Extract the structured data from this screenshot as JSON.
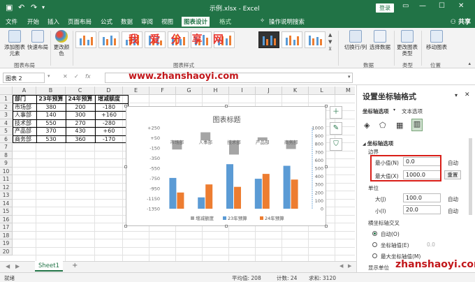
{
  "window": {
    "title": "示例.xlsx - Excel",
    "login": "登录",
    "share": "共享"
  },
  "tabs": [
    "文件",
    "开始",
    "插入",
    "页面布局",
    "公式",
    "数据",
    "审阅",
    "视图",
    "图表设计",
    "格式"
  ],
  "tell_me": "操作说明搜索",
  "ribbon": {
    "buttons": [
      "添加图表元素",
      "快速布局",
      "更改颜色",
      "切换行/列",
      "选择数据",
      "更改图表类型",
      "移动图表"
    ],
    "groups": [
      "图表布局",
      "图表样式",
      "数据",
      "类型",
      "位置"
    ]
  },
  "watermark": {
    "cn": "我 爱 分 享 网",
    "url": "www.zhanshaoyi.com",
    "corner": "zhanshaoyi.com"
  },
  "formula_bar": {
    "name_box": "图表 2",
    "fx": "fx"
  },
  "grid": {
    "columns": [
      "A",
      "B",
      "C",
      "D",
      "E",
      "F",
      "G",
      "H",
      "I",
      "J",
      "K",
      "L",
      "M"
    ],
    "rows": [
      "1",
      "2",
      "3",
      "4",
      "5",
      "6",
      "7",
      "8",
      "9",
      "10",
      "11",
      "12",
      "13",
      "14",
      "15",
      "16",
      "17",
      "18",
      "19",
      "20"
    ],
    "table": [
      [
        "部门",
        "23年预算",
        "24年预算",
        "增减额度"
      ],
      [
        "市场部",
        "380",
        "200",
        "-180"
      ],
      [
        "人事部",
        "140",
        "300",
        "+160"
      ],
      [
        "技术部",
        "550",
        "270",
        "-280"
      ],
      [
        "产品部",
        "370",
        "430",
        "+60"
      ],
      [
        "商务部",
        "530",
        "360",
        "-170"
      ]
    ]
  },
  "chart_data": {
    "type": "bar",
    "title": "图表标题",
    "categories": [
      "市场部",
      "人事部",
      "技术部",
      "产品部",
      "商务部"
    ],
    "series": [
      {
        "name": "增减额度",
        "values": [
          -180,
          160,
          -280,
          60,
          -170
        ],
        "color": "#a5a5a5",
        "axis": "left"
      },
      {
        "name": "23年预算",
        "values": [
          380,
          140,
          550,
          370,
          530
        ],
        "color": "#5b9bd5",
        "axis": "right"
      },
      {
        "name": "24年预算",
        "values": [
          200,
          300,
          270,
          430,
          360
        ],
        "color": "#ed7d31",
        "axis": "right"
      }
    ],
    "left_axis": {
      "ticks": [
        "+250",
        "+50",
        "-150",
        "-350",
        "-550",
        "-750",
        "-950",
        "-1150",
        "-1350"
      ],
      "min": -1350,
      "max": 250
    },
    "right_axis": {
      "ticks": [
        "1000",
        "900",
        "800",
        "700",
        "600",
        "500",
        "400",
        "300",
        "200",
        "100",
        "0"
      ],
      "min": 0,
      "max": 1000
    },
    "legend": "bottom"
  },
  "sheet": {
    "tab": "Sheet1",
    "add": "+"
  },
  "status": {
    "ready": "就绪",
    "average": "平均值: 208",
    "count": "计数: 24",
    "sum": "求和: 3120"
  },
  "pane": {
    "title": "设置坐标轴格式",
    "subtabs": [
      "坐标轴选项",
      "文本选项"
    ],
    "section": "坐标轴选项",
    "bounds": "边界",
    "min_label": "最小值(N)",
    "min_value": "0.0",
    "max_label": "最大值(X)",
    "max_value": "1000.0",
    "auto": "自动",
    "reset": "重置",
    "units": "单位",
    "major_label": "大(J)",
    "major_value": "100.0",
    "minor_label": "小(I)",
    "minor_value": "20.0",
    "cross": "横坐标轴交叉",
    "radio_auto": "自动(O)",
    "radio_value": "坐标轴值(E)",
    "radio_value_num": "0.0",
    "radio_max": "最大坐标轴值(M)",
    "display_units": "显示单位"
  }
}
